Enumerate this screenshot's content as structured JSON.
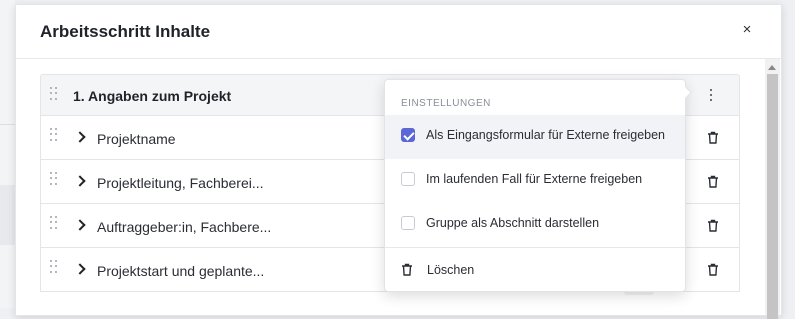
{
  "modal": {
    "title": "Arbeitsschritt Inhalte",
    "close_glyph": "×"
  },
  "group": {
    "title": "1. Angaben zum Projekt"
  },
  "rows": [
    {
      "label": "Projektname"
    },
    {
      "label": "Projektleitung, Fachberei..."
    },
    {
      "label": "Auftraggeber:in, Fachbere..."
    },
    {
      "label": "Projektstart und geplante..."
    }
  ],
  "dropdown": {
    "section_label": "EINSTELLUNGEN",
    "options": [
      {
        "label": "Als Eingangsformular für Externe freigeben",
        "checked": true
      },
      {
        "label": "Im laufenden Fall für Externe freigeben",
        "checked": false
      },
      {
        "label": "Gruppe als Abschnitt darstellen",
        "checked": false
      }
    ],
    "delete_label": "Löschen"
  },
  "colors": {
    "accent": "#5b67d6"
  },
  "icons": [
    "drag-handle-icon",
    "chevron-right-icon",
    "kebab-menu-icon",
    "trash-icon",
    "close-icon",
    "checkbox-icon"
  ]
}
